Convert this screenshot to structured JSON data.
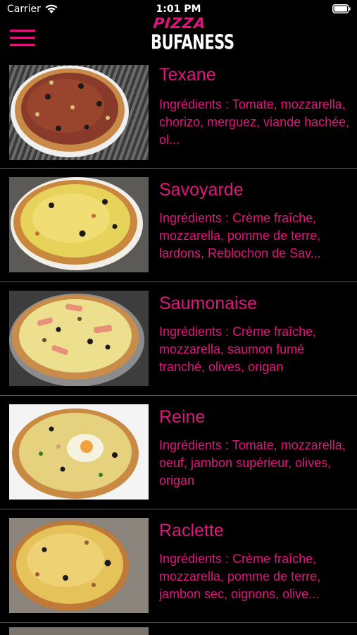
{
  "status_bar": {
    "carrier": "Carrier",
    "time": "1:01 PM"
  },
  "header": {
    "logo_top": "PIZZA",
    "logo_bottom": "BUFANESS",
    "menu_icon": "hamburger-menu-icon"
  },
  "colors": {
    "accent": "#e4147e",
    "background": "#000000",
    "divider": "#5a5a5a"
  },
  "pizzas": [
    {
      "name": "Texane",
      "description": "Ingrédients : Tomate, mozzarella, chorizo, merguez, viande hachée, ol...",
      "image": "pizza-texane-photo"
    },
    {
      "name": "Savoyarde",
      "description": "Ingrédients : Crème fraîche, mozzarella, pomme de terre, lardons, Reblochon de Sav...",
      "image": "pizza-savoyarde-photo"
    },
    {
      "name": "Saumonaise",
      "description": "Ingrédients : Crème fraîche, mozzarella, saumon fumé tranché, olives, origan",
      "image": "pizza-saumonaise-photo"
    },
    {
      "name": "Reine",
      "description": "Ingrédients : Tomate, mozzarella, oeuf,  jambon supérieur, olives, origan",
      "image": "pizza-reine-photo"
    },
    {
      "name": "Raclette",
      "description": "Ingrédients : Crème fraîche, mozzarella, pomme de terre, jambon sec, oignons, olive...",
      "image": "pizza-raclette-photo"
    }
  ]
}
